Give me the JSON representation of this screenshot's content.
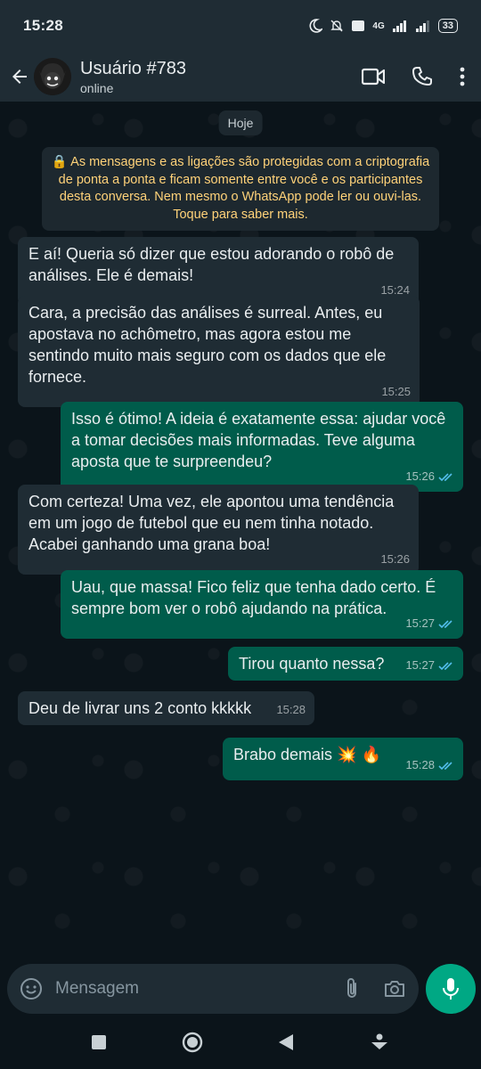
{
  "status_bar": {
    "time": "15:28",
    "network": "4G",
    "battery": "33"
  },
  "header": {
    "contact_name": "Usuário #783",
    "presence": "online"
  },
  "chat": {
    "date_chip": "Hoje",
    "encryption_notice": "🔒 As mensagens e as ligações são protegidas com a criptografia de ponta a ponta e ficam somente entre você e os participantes desta conversa. Nem mesmo o WhatsApp pode ler ou ouvi-las. Toque para saber mais.",
    "messages": [
      {
        "direction": "in",
        "text": "E aí! Queria só dizer que estou adorando o robô de análises. Ele é demais!",
        "time": "15:24"
      },
      {
        "direction": "in",
        "text": "Cara, a precisão das análises é surreal. Antes, eu apostava no achômetro, mas agora estou me sentindo muito mais seguro com os dados que ele fornece.",
        "time": "15:25"
      },
      {
        "direction": "out",
        "text": "Isso é ótimo! A ideia é exatamente essa: ajudar você a tomar decisões mais informadas. Teve alguma aposta que te surpreendeu?",
        "time": "15:26",
        "status": "read"
      },
      {
        "direction": "in",
        "text": "Com certeza! Uma vez, ele apontou uma tendência em um jogo de futebol que eu nem tinha notado. Acabei ganhando uma grana boa!",
        "time": "15:26"
      },
      {
        "direction": "out",
        "text": "Uau, que massa! Fico feliz que tenha dado certo. É sempre bom ver o robô ajudando na prática.",
        "time": "15:27",
        "status": "read"
      },
      {
        "direction": "out",
        "text": "Tirou quanto nessa?",
        "time": "15:27",
        "status": "read"
      },
      {
        "direction": "in",
        "text": "Deu de livrar uns 2 conto kkkkk",
        "time": "15:28"
      },
      {
        "direction": "out",
        "text": "Brabo demais 💥 🔥",
        "time": "15:28",
        "status": "read"
      }
    ]
  },
  "composer": {
    "placeholder": "Mensagem"
  },
  "icons": {
    "back": "arrow-left-icon",
    "video": "video-call-icon",
    "call": "phone-icon",
    "menu": "more-vert-icon",
    "emoji": "emoji-icon",
    "attach": "paperclip-icon",
    "camera": "camera-icon",
    "mic": "microphone-icon"
  },
  "colors": {
    "incoming_bubble": "#1f2c34",
    "outgoing_bubble": "#005c4b",
    "accent": "#00a884",
    "read_ticks": "#53bdeb",
    "notice_text": "#ffd279"
  }
}
